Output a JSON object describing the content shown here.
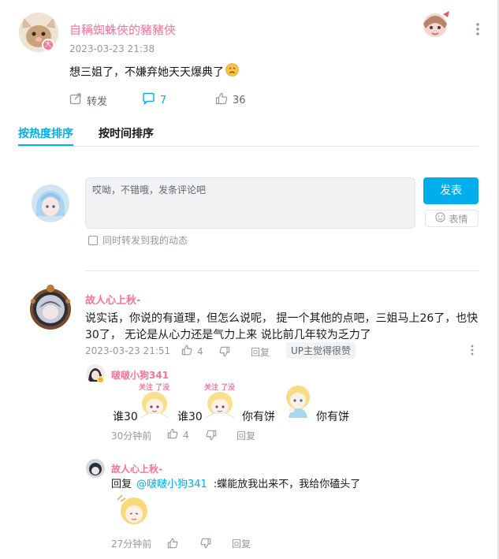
{
  "post": {
    "author": "自稱蜘蛛俠的豬豬俠",
    "badge": "大",
    "time": "2023-03-23 21:38",
    "content": "想三姐了，不嫌弃她天天爆典了",
    "actions": {
      "forward": "转发",
      "comments": "7",
      "likes": "36"
    }
  },
  "sort_tabs": {
    "hot": "按热度排序",
    "time": "按时间排序"
  },
  "composer": {
    "placeholder": "哎呦，不错哦，发条评论吧",
    "submit": "发表",
    "emoji": "表情",
    "sync_label": "同时转发到我的动态"
  },
  "comments": [
    {
      "user": "故人心上秋-",
      "text_line1": "说实话，你说的有道理，但怎么说呢， 提一个其他的点吧，三姐马上26了，也快",
      "text_line2": "30了， 无论是从心力还是气力上来 说比前几年较为乏力了",
      "time": "2023-03-23 21:51",
      "likes": "4",
      "reply_label": "回复",
      "up_badge": "UP主觉得很赞",
      "replies": [
        {
          "user": "啵啵小狗341",
          "seg1": "谁30",
          "seg2": "谁30",
          "seg3": "你有饼",
          "seg4": "你有饼",
          "sticker_text": "关注  了没",
          "time": "30分钟前",
          "likes": "4",
          "reply_label": "回复"
        },
        {
          "user": "故人心上秋-",
          "prefix": "回复",
          "mention": "@啵啵小狗341",
          "text": ":蝶能放我出来不，我给你磕头了",
          "time": "27分钟前",
          "reply_label": "回复"
        }
      ]
    }
  ],
  "colors": {
    "accent": "#00aeec",
    "pink": "#fb7299",
    "grey": "#9499a0"
  }
}
